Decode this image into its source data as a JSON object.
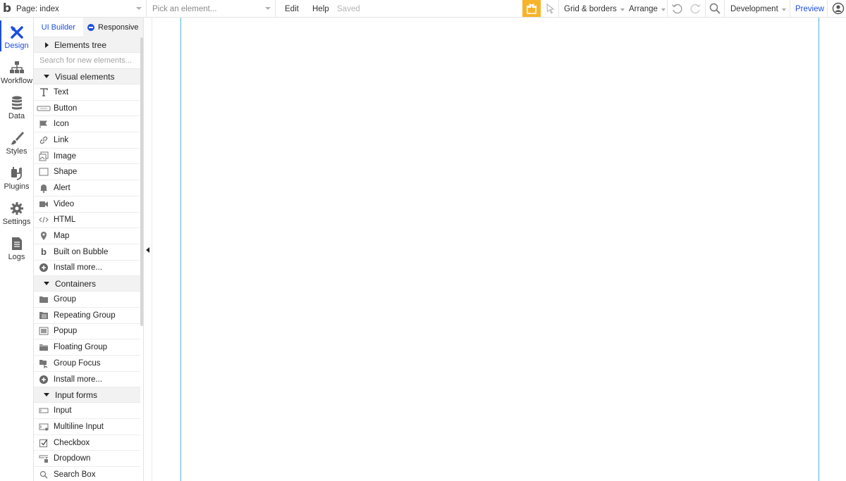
{
  "topbar": {
    "logo": "b",
    "page_label": "Page: index",
    "pick_placeholder": "Pick an element...",
    "edit": "Edit",
    "help": "Help",
    "saved": "Saved",
    "grid_borders": "Grid & borders",
    "arrange": "Arrange",
    "environment": "Development",
    "preview": "Preview",
    "gift_color": "#f7b32b",
    "accent_color": "#1d4fe0"
  },
  "rail": [
    {
      "label": "Design",
      "icon": "design-icon",
      "active": true
    },
    {
      "label": "Workflow",
      "icon": "workflow-icon"
    },
    {
      "label": "Data",
      "icon": "database-icon"
    },
    {
      "label": "Styles",
      "icon": "brush-icon"
    },
    {
      "label": "Plugins",
      "icon": "plugin-icon"
    },
    {
      "label": "Settings",
      "icon": "gear-icon"
    },
    {
      "label": "Logs",
      "icon": "document-icon"
    }
  ],
  "palette": {
    "tab_ui_builder": "UI Builder",
    "tab_responsive": "Responsive",
    "elements_tree": "Elements tree",
    "search_placeholder": "Search for new elements...",
    "visual_header": "Visual elements",
    "visual": [
      "Text",
      "Button",
      "Icon",
      "Link",
      "Image",
      "Shape",
      "Alert",
      "Video",
      "HTML",
      "Map",
      "Built on Bubble",
      "Install more..."
    ],
    "containers_header": "Containers",
    "containers": [
      "Group",
      "Repeating Group",
      "Popup",
      "Floating Group",
      "Group Focus",
      "Install more..."
    ],
    "inputs_header": "Input forms",
    "inputs": [
      "Input",
      "Multiline Input",
      "Checkbox",
      "Dropdown",
      "Search Box"
    ]
  },
  "canvas": {
    "page_border_color": "#52b6d3"
  }
}
